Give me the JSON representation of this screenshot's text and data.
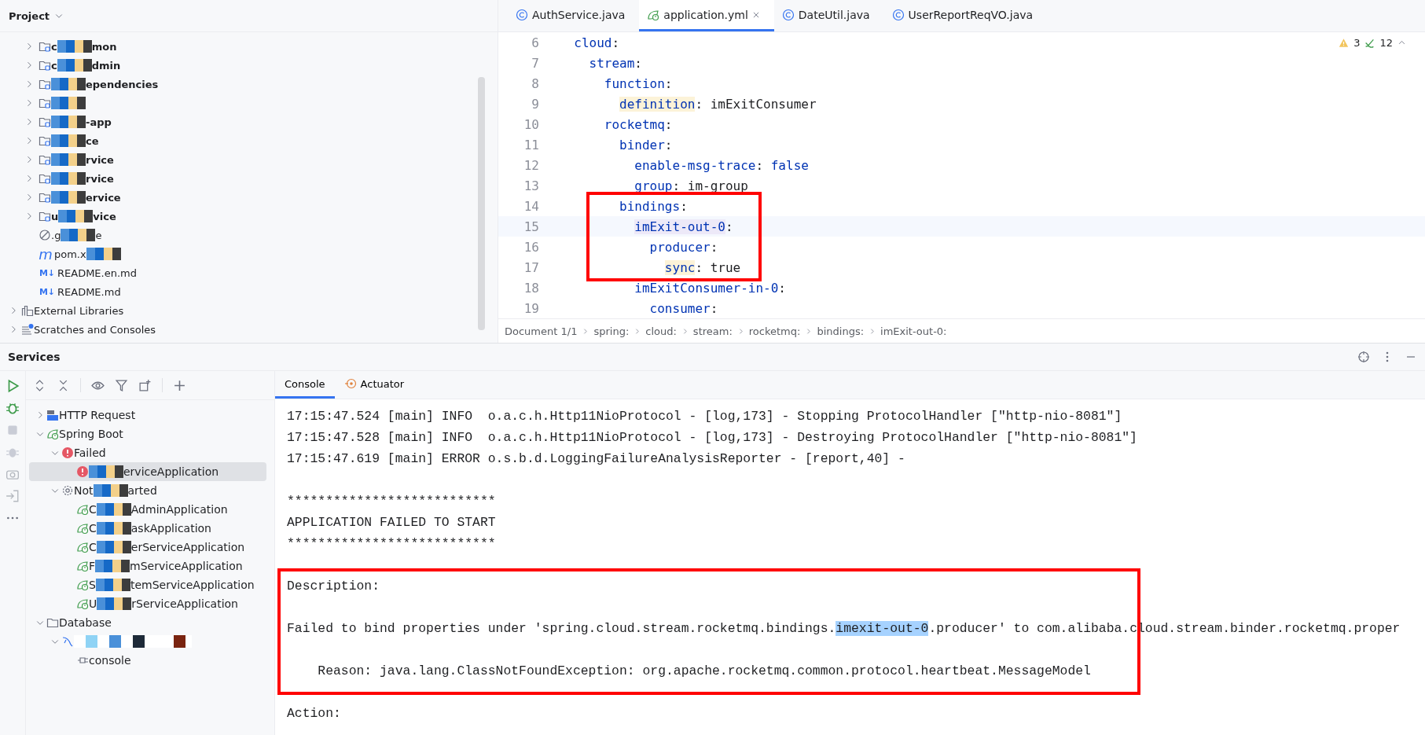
{
  "project": {
    "title": "Project",
    "items": [
      {
        "kind": "module",
        "pre": "c",
        "post": "mon",
        "expanded": false
      },
      {
        "kind": "module",
        "pre": "c",
        "post": "dmin",
        "expanded": false
      },
      {
        "kind": "module",
        "post": "ependencies",
        "expanded": false
      },
      {
        "kind": "module",
        "expanded": false
      },
      {
        "kind": "module",
        "post": "-app",
        "expanded": false
      },
      {
        "kind": "module",
        "post": "ce",
        "expanded": false
      },
      {
        "kind": "module",
        "post": "rvice",
        "expanded": false
      },
      {
        "kind": "module",
        "post": "rvice",
        "expanded": false
      },
      {
        "kind": "module",
        "post": "ervice",
        "expanded": false
      },
      {
        "kind": "module",
        "pre": "u",
        "post": "vice",
        "expanded": false
      },
      {
        "kind": "ignore",
        "pre": ".g",
        "post": "e"
      },
      {
        "kind": "maven",
        "badge": "m",
        "pre": "pom.x"
      },
      {
        "kind": "markdown",
        "badge": "M↓",
        "pre": "README.en.md"
      },
      {
        "kind": "markdown",
        "badge": "M↓",
        "pre": "README.md"
      }
    ],
    "roots": [
      {
        "kind": "library",
        "label": "External Libraries",
        "expanded": false
      },
      {
        "kind": "scratch",
        "label": "Scratches and Consoles",
        "expanded": false
      }
    ]
  },
  "editor": {
    "tabs": [
      {
        "kind": "class",
        "label": "AuthService.java",
        "selected": false
      },
      {
        "kind": "spring",
        "label": "application.yml",
        "selected": true,
        "closable": true
      },
      {
        "kind": "class",
        "label": "DateUtil.java",
        "selected": false
      },
      {
        "kind": "class",
        "label": "UserReportReqVO.java",
        "selected": false
      }
    ],
    "inspections": {
      "warnings": "3",
      "typos": "12"
    },
    "lines": [
      {
        "number": "6",
        "text": "  cloud:"
      },
      {
        "number": "7",
        "text": "    stream:"
      },
      {
        "number": "8",
        "text": "      function:"
      },
      {
        "number": "9",
        "text": "        definition: imExitConsumer",
        "usage_highlight": true
      },
      {
        "number": "10",
        "text": "      rocketmq:"
      },
      {
        "number": "11",
        "text": "        binder:"
      },
      {
        "number": "12",
        "text": "          enable-msg-trace: false",
        "value_keyword": true
      },
      {
        "number": "13",
        "text": "          group: im-group"
      },
      {
        "number": "14",
        "text": "        bindings:"
      },
      {
        "number": "15",
        "text": "          imExit-out-0:",
        "caret_highlight": true,
        "current": true
      },
      {
        "number": "16",
        "text": "            producer:"
      },
      {
        "number": "17",
        "text": "              sync: true",
        "usage_highlight": true
      },
      {
        "number": "18",
        "text": "          imExitConsumer-in-0:"
      },
      {
        "number": "19",
        "text": "            consumer:"
      }
    ],
    "breadcrumbs": [
      "Document 1/1",
      "spring:",
      "cloud:",
      "stream:",
      "rocketmq:",
      "bindings:",
      "imExit-out-0:"
    ]
  },
  "services": {
    "title": "Services",
    "tree": [
      {
        "kind": "http",
        "label": "HTTP Request",
        "expanded": false
      },
      {
        "kind": "spring",
        "label": "Spring Boot",
        "expanded": true,
        "children": [
          {
            "kind": "failed",
            "label": "Failed",
            "expanded": true,
            "children": [
              {
                "kind": "app-failed",
                "post": "erviceApplication",
                "selected": true
              }
            ]
          },
          {
            "kind": "not-started",
            "pre": "Not",
            "post": "arted",
            "expanded": true,
            "children": [
              {
                "kind": "app",
                "pre": "C",
                "post": "AdminApplication",
                "selected": false
              },
              {
                "kind": "app",
                "pre": "C",
                "post": "askApplication",
                "selected": false
              },
              {
                "kind": "app",
                "pre": "C",
                "post": "erServiceApplication",
                "selected": false
              },
              {
                "kind": "app",
                "pre": "F",
                "post": "mServiceApplication",
                "selected": false
              },
              {
                "kind": "app",
                "pre": "S",
                "post": "temServiceApplication",
                "selected": false
              },
              {
                "kind": "app",
                "pre": "U",
                "post": "rServiceApplication",
                "selected": false
              }
            ]
          }
        ]
      },
      {
        "kind": "database",
        "label": "Database",
        "expanded": true,
        "children": [
          {
            "kind": "datasource",
            "expanded": true,
            "children": [
              {
                "kind": "console",
                "label": "console"
              }
            ]
          }
        ]
      }
    ],
    "console": {
      "tabs": [
        {
          "label": "Console",
          "selected": true
        },
        {
          "label": "Actuator",
          "selected": false,
          "kind": "actuator"
        }
      ],
      "lines": [
        {
          "segments": [
            {
              "text": "17:15:47.524 [main] INFO  o.a.c.h.Http11NioProtocol - [log,173] - Stopping ProtocolHandler [\"http-nio-8081\"]",
              "selected": false
            }
          ]
        },
        {
          "segments": [
            {
              "text": "17:15:47.528 [main] INFO  o.a.c.h.Http11NioProtocol - [log,173] - Destroying ProtocolHandler [\"http-nio-8081\"]",
              "selected": false
            }
          ]
        },
        {
          "segments": [
            {
              "text": "17:15:47.619 [main] ERROR o.s.b.d.LoggingFailureAnalysisReporter - [report,40] -",
              "selected": false
            }
          ]
        },
        {
          "gap_before": true,
          "segments": [
            {
              "text": "***************************",
              "selected": false
            }
          ]
        },
        {
          "segments": [
            {
              "text": "APPLICATION FAILED TO START",
              "selected": false
            }
          ]
        },
        {
          "segments": [
            {
              "text": "***************************",
              "selected": false
            }
          ]
        },
        {
          "gap_before": true,
          "segments": [
            {
              "text": "Description:",
              "selected": false
            }
          ]
        },
        {
          "gap_before": true,
          "segments": [
            {
              "text": "Failed to bind properties under 'spring.cloud.stream.rocketmq.bindings.",
              "selected": false
            },
            {
              "text": "imexit-out-0",
              "selected": true
            },
            {
              "text": ".producer' to com.alibaba.cloud.stream.binder.rocketmq.proper",
              "selected": false
            }
          ]
        },
        {
          "gap_before": true,
          "segments": [
            {
              "text": "    Reason: java.lang.ClassNotFoundException: org.apache.rocketmq.common.protocol.heartbeat.MessageModel",
              "selected": false
            }
          ]
        },
        {
          "gap_before": true,
          "segments": [
            {
              "text": "Action:",
              "selected": false
            }
          ]
        }
      ]
    }
  }
}
